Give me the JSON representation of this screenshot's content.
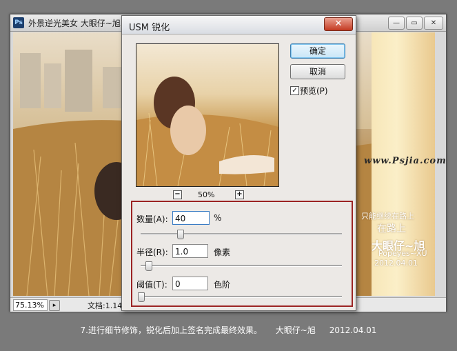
{
  "document_window": {
    "title": "外景逆光美女  大眼仔~旭",
    "app_icon_text": "Ps",
    "controls": {
      "minimize": "—",
      "maximize": "▭",
      "close": "✕"
    },
    "status": {
      "zoom": "75.13%",
      "doc_size": "文档:1.14"
    },
    "watermark": "www.Psjia.com",
    "signature_lines": [
      "只能继续在路上",
      "在路上",
      "大眼仔~旭",
      "Popeyes~XU",
      "2012.04.01"
    ]
  },
  "dialog": {
    "title": "USM 锐化",
    "close_label": "✕",
    "ok_label": "确定",
    "cancel_label": "取消",
    "preview_checked": true,
    "preview_label": "预览(P)",
    "preview_zoom": "50%",
    "zoom_out": "−",
    "zoom_in": "+",
    "params": [
      {
        "label": "数量(A):",
        "value": "40",
        "unit": "%",
        "slider_fraction": 0.2
      },
      {
        "label": "半径(R):",
        "value": "1.0",
        "unit": "像素",
        "slider_fraction": 0.04
      },
      {
        "label": "阈值(T):",
        "value": "0",
        "unit": "色阶",
        "slider_fraction": 0.0
      }
    ]
  },
  "caption": {
    "step": "7.进行细节修饰，锐化后加上签名完成最终效果。",
    "author": "大眼仔~旭",
    "date": "2012.04.01"
  }
}
